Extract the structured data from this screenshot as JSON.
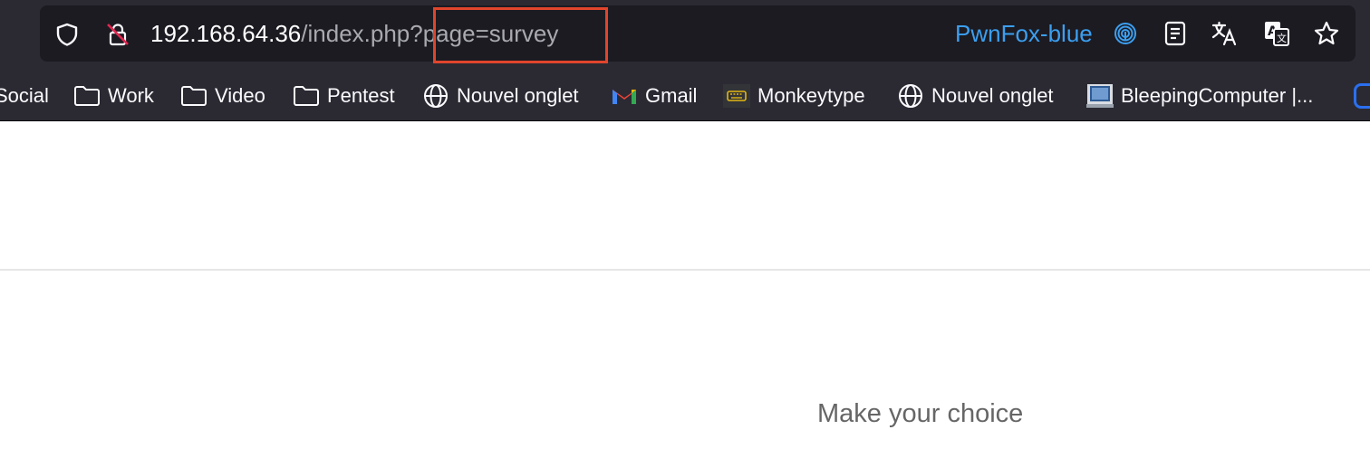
{
  "browser": {
    "url": {
      "host": "192.168.64.36",
      "path": "/index.php",
      "query": "?page=survey"
    },
    "container_tab": "PwnFox-blue",
    "accent_color": "#3b9ff0",
    "highlight_color": "#e0452c",
    "icons": {
      "shield": "shield-icon",
      "lock": "insecure-lock-icon",
      "fingerprint": "fingerprint-icon",
      "reader": "reader-view-icon",
      "translate": "translate-icon",
      "translate_alt": "translate-page-icon",
      "bookmark_star": "star-icon"
    }
  },
  "bookmarks": [
    {
      "label": "Social",
      "icon": "folder-icon"
    },
    {
      "label": "Work",
      "icon": "folder-icon"
    },
    {
      "label": "Video",
      "icon": "folder-icon"
    },
    {
      "label": "Pentest",
      "icon": "folder-icon"
    },
    {
      "label": "Nouvel onglet",
      "icon": "globe-icon"
    },
    {
      "label": "Gmail",
      "icon": "gmail-icon"
    },
    {
      "label": "Monkeytype",
      "icon": "keyboard-icon"
    },
    {
      "label": "Nouvel onglet",
      "icon": "globe-icon"
    },
    {
      "label": "BleepingComputer |...",
      "icon": "monitor-icon"
    }
  ],
  "page": {
    "heading": "Make your choice"
  }
}
